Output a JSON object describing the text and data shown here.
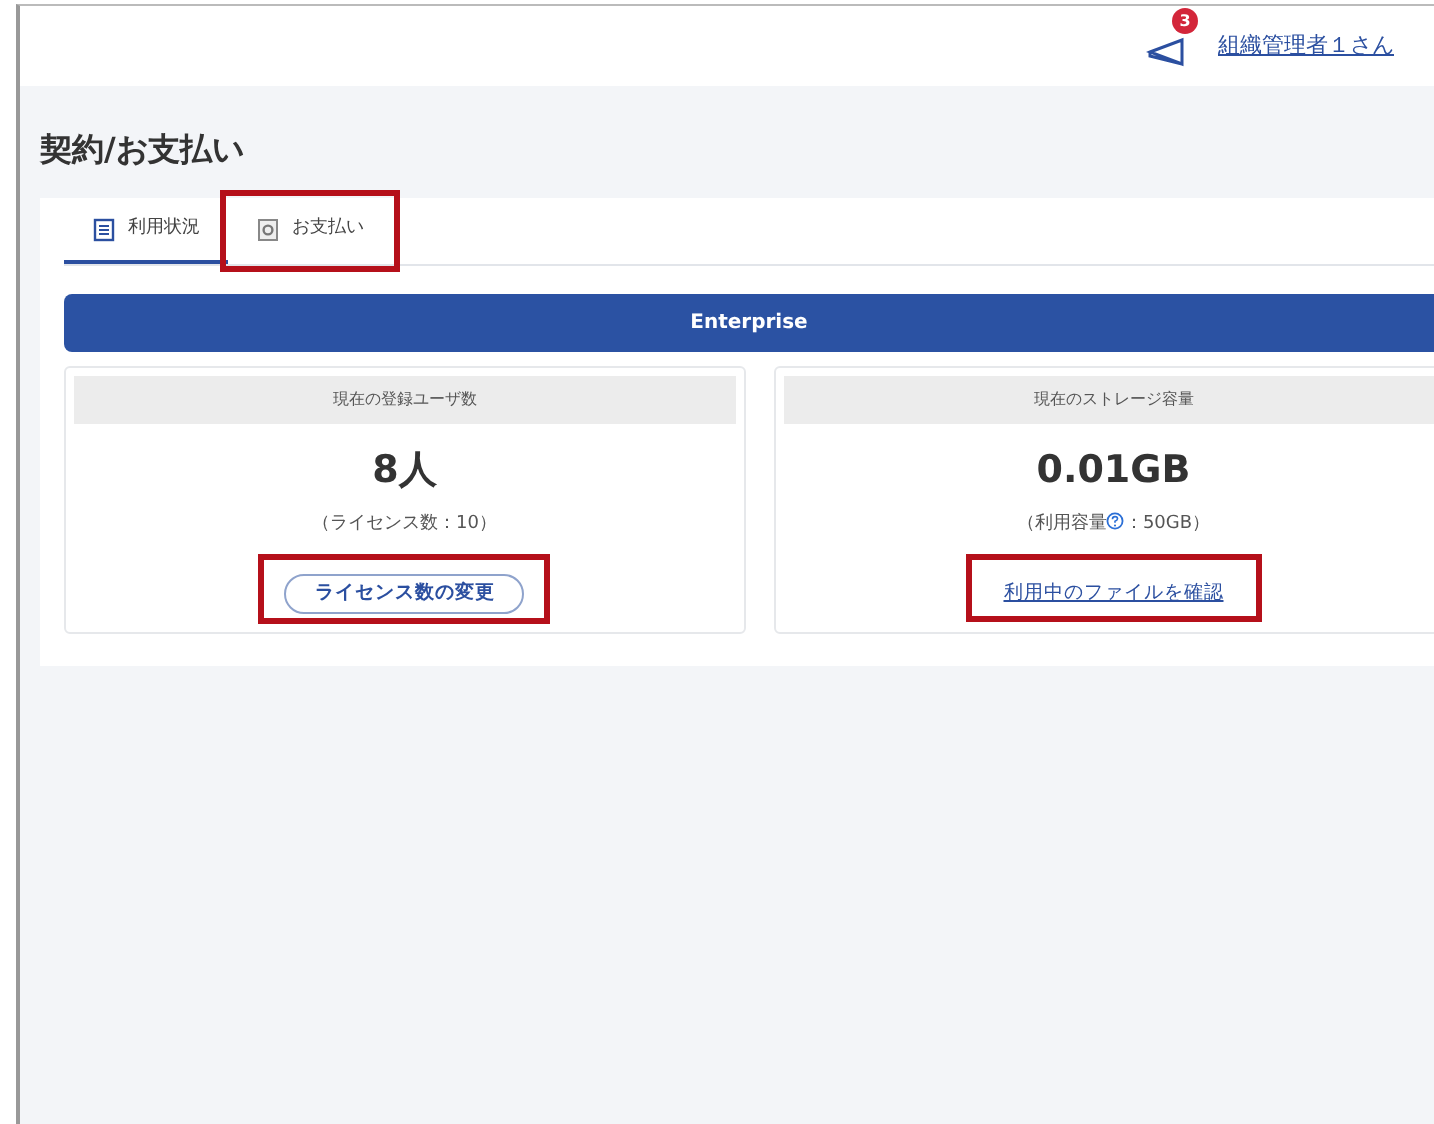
{
  "header": {
    "notification_count": "3",
    "user_link": "組織管理者１さん"
  },
  "page_title": "契約/お支払い",
  "tabs": [
    {
      "label": "利用状況",
      "kind": "list",
      "selected": true,
      "highlighted": false
    },
    {
      "label": "お支払い",
      "kind": "document",
      "selected": false,
      "highlighted": true
    }
  ],
  "plan": "Enterprise",
  "cards": [
    {
      "heading": "現在の登録ユーザ数",
      "value": "8人",
      "note": "（ライセンス数：10）",
      "action": {
        "kind": "button",
        "label": "ライセンス数の変更",
        "highlighted": true
      }
    },
    {
      "heading": "現在のストレージ容量",
      "value": "0.01GB",
      "note": "（利用容量",
      "note_help": true,
      "note_after": "：50GB）",
      "action": {
        "kind": "link",
        "label": "利用中のファイルを確認",
        "highlighted": true
      }
    }
  ]
}
